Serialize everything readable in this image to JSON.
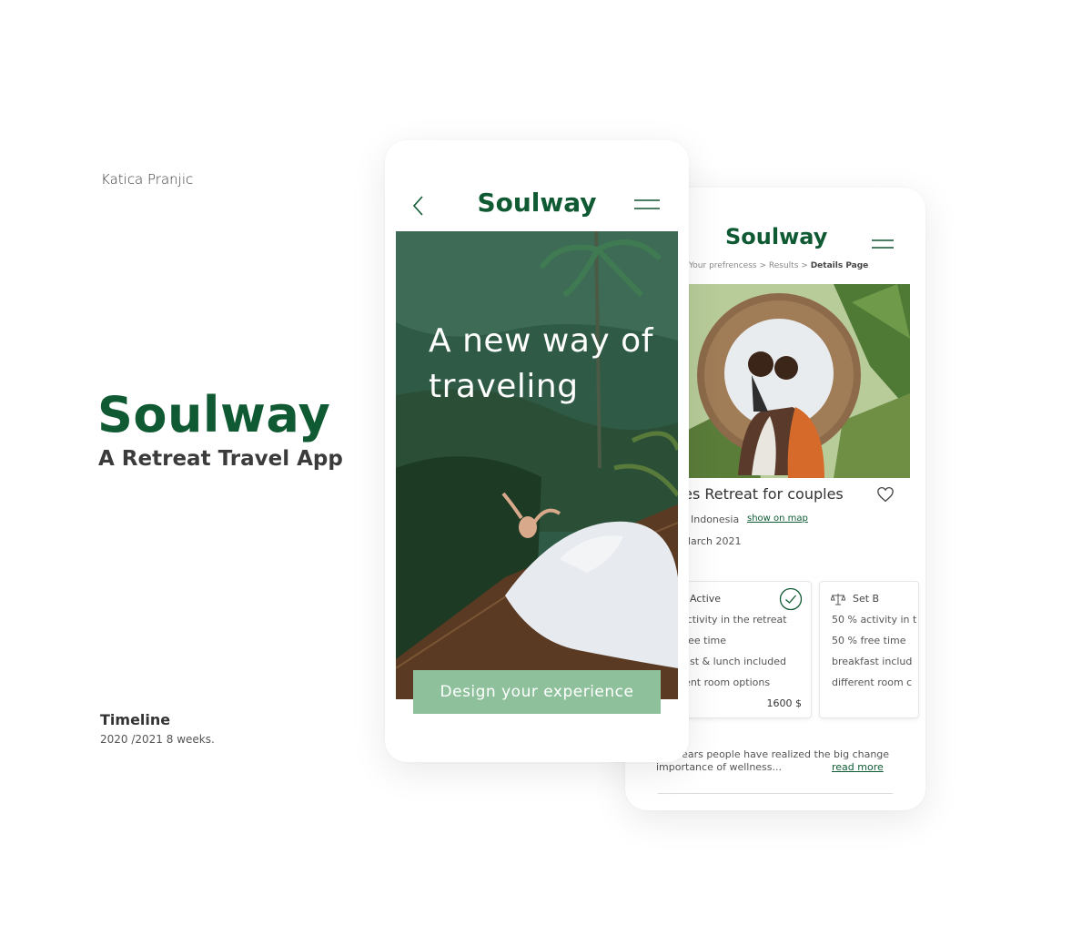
{
  "cover": {
    "author": "Katica Pranjic",
    "title": "Soulway",
    "subtitle": "A Retreat Travel App",
    "timeline_label": "Timeline",
    "timeline_value": "2020 /2021 8 weeks."
  },
  "front_screen": {
    "logo": "Soulway",
    "hero_text": "A new way of traveling",
    "cta_label": "Design your experience",
    "icons": [
      "chevron-left-icon",
      "menu-icon"
    ]
  },
  "detail_screen": {
    "logo": "Soulway",
    "breadcrumb": {
      "items": [
        "Your prefrencess",
        "Results"
      ],
      "separator": ">",
      "current": "Details Page"
    },
    "retreat_title": "nes Retreat for couples",
    "location": "Indonesia",
    "map_link": "show on map",
    "date": "0 March 2021",
    "cards": [
      {
        "title": "Active",
        "lines": [
          ". activity in the retreat",
          "free time",
          "kfast & lunch included",
          "erent room options"
        ],
        "price": "1600 $",
        "selected": true
      },
      {
        "title": "Set B",
        "lines": [
          "50 % activity in t",
          "50 % free time",
          "breakfast includ",
          "different room c"
        ]
      }
    ],
    "description": "ent years people have realized the big change importance of wellness...",
    "read_more": "read more",
    "icons": [
      "menu-icon",
      "heart-icon",
      "check-circle-icon",
      "scale-icon"
    ]
  },
  "colors": {
    "brand_green": "#0f5a33",
    "cta_green": "#8ec19b",
    "text_dark": "#333333"
  }
}
